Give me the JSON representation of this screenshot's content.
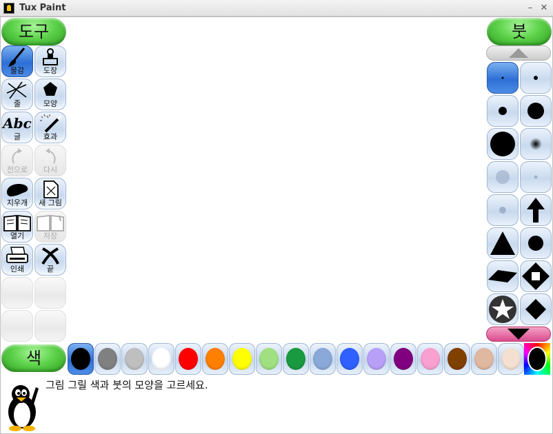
{
  "window": {
    "title": "Tux Paint",
    "minimize": "–",
    "close": "✕"
  },
  "tools_header": "도구",
  "tools": [
    {
      "label": "물감",
      "icon": "paint-brush-icon",
      "state": "selected"
    },
    {
      "label": "도장",
      "icon": "stamp-icon",
      "state": "normal"
    },
    {
      "label": "줄",
      "icon": "lines-icon",
      "state": "normal"
    },
    {
      "label": "모양",
      "icon": "pentagon-icon",
      "state": "normal"
    },
    {
      "label": "글",
      "icon": "text-abc-icon",
      "state": "normal",
      "icon_text": "Abc"
    },
    {
      "label": "효과",
      "icon": "magic-wand-icon",
      "state": "normal"
    },
    {
      "label": "전으로",
      "icon": "undo-icon",
      "state": "disabled"
    },
    {
      "label": "다시",
      "icon": "redo-icon",
      "state": "disabled"
    },
    {
      "label": "지우개",
      "icon": "eraser-icon",
      "state": "normal"
    },
    {
      "label": "새 그림",
      "icon": "new-page-icon",
      "state": "normal"
    },
    {
      "label": "열기",
      "icon": "open-book-icon",
      "state": "normal"
    },
    {
      "label": "저장",
      "icon": "save-book-icon",
      "state": "disabled"
    },
    {
      "label": "인쇄",
      "icon": "printer-icon",
      "state": "normal"
    },
    {
      "label": "끝",
      "icon": "quit-x-icon",
      "state": "normal"
    }
  ],
  "brushes_header": "붓",
  "brushes": [
    {
      "icon": "brush-tiny-dot-icon",
      "selected": true
    },
    {
      "icon": "brush-small-dot-icon",
      "selected": false
    },
    {
      "icon": "brush-medium-dot-icon",
      "selected": false
    },
    {
      "icon": "brush-large-dot-icon",
      "selected": false
    },
    {
      "icon": "brush-xlarge-dot-icon",
      "selected": false
    },
    {
      "icon": "brush-fuzzy-dot-icon",
      "selected": false
    },
    {
      "icon": "brush-gray-blob-icon",
      "selected": false
    },
    {
      "icon": "brush-gray-tiny-icon",
      "selected": false
    },
    {
      "icon": "brush-gray-small-icon",
      "selected": false
    },
    {
      "icon": "brush-arrow-up-icon",
      "selected": false
    },
    {
      "icon": "brush-triangle-icon",
      "selected": false
    },
    {
      "icon": "brush-circle-icon",
      "selected": false
    },
    {
      "icon": "brush-parallelogram-icon",
      "selected": false
    },
    {
      "icon": "brush-diamond-outline-icon",
      "selected": false
    },
    {
      "icon": "brush-star-icon",
      "selected": false
    },
    {
      "icon": "brush-diamond-icon",
      "selected": false
    }
  ],
  "colors_header": "색",
  "colors": [
    {
      "name": "black",
      "hex": "#000000",
      "selected": true
    },
    {
      "name": "dark-gray",
      "hex": "#808080"
    },
    {
      "name": "light-gray",
      "hex": "#bfbfbf"
    },
    {
      "name": "white",
      "hex": "#ffffff"
    },
    {
      "name": "red",
      "hex": "#ff0000"
    },
    {
      "name": "orange",
      "hex": "#ff7f00"
    },
    {
      "name": "yellow",
      "hex": "#ffff00"
    },
    {
      "name": "light-green",
      "hex": "#a0e080"
    },
    {
      "name": "green",
      "hex": "#1a9a40"
    },
    {
      "name": "sky-blue",
      "hex": "#8aa9d8"
    },
    {
      "name": "blue",
      "hex": "#3060ff"
    },
    {
      "name": "lavender",
      "hex": "#b8a0f8"
    },
    {
      "name": "purple",
      "hex": "#800080"
    },
    {
      "name": "pink",
      "hex": "#f8a0d0"
    },
    {
      "name": "brown",
      "hex": "#804000"
    },
    {
      "name": "tan",
      "hex": "#e0b8a0"
    },
    {
      "name": "beige",
      "hex": "#f4e0d0"
    }
  ],
  "rainbow_color": {
    "name": "color-picker",
    "hex": "#000000"
  },
  "status_message": "그림 그릴 색과 붓의 모양을 고르세요."
}
